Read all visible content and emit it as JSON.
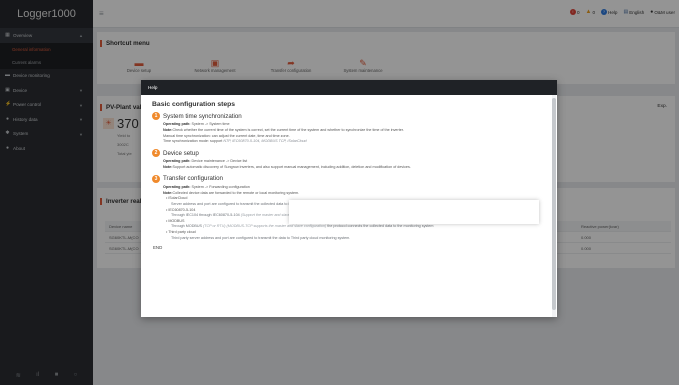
{
  "app": {
    "title": "Logger1000"
  },
  "header": {
    "alarm_count": "0",
    "warn_count": "0",
    "help": "Help",
    "language": "English",
    "user": "O&M user"
  },
  "sidebar": {
    "items": [
      {
        "label": "Overview",
        "icon": "grid-icon"
      },
      {
        "label": "General information",
        "sub": true,
        "active": true
      },
      {
        "label": "Current alarms",
        "sub": true
      },
      {
        "label": "Device monitoring",
        "icon": "monitor-icon"
      },
      {
        "label": "Device",
        "icon": "device-icon"
      },
      {
        "label": "Power control",
        "icon": "power-icon"
      },
      {
        "label": "History data",
        "icon": "history-icon"
      },
      {
        "label": "System",
        "icon": "gear-icon"
      },
      {
        "label": "About",
        "icon": "info-icon"
      }
    ]
  },
  "shortcut": {
    "title": "Shortcut menu",
    "items": [
      "Device setup",
      "Network management",
      "Transfer configuration",
      "System maintenance"
    ]
  },
  "pvplant": {
    "title": "PV-Plant values",
    "big_value": "370",
    "exp": "Exp.",
    "small1": "Yield to",
    "small2": "3002C",
    "small3": "Total yie"
  },
  "inverter": {
    "title": "Inverter realt",
    "col1": "Device name",
    "col2": "Reactive power(kvar)",
    "rows": [
      {
        "name": "SG60KTL-M(CO",
        "value": "0.000"
      },
      {
        "name": "SG60KTL-M(CO",
        "value": "0.000"
      }
    ]
  },
  "modal": {
    "header": "Help",
    "title": "Basic configuration steps",
    "steps": [
      {
        "num": "1",
        "title": "System time synchronization",
        "lines": [
          {
            "k": "Operating path:",
            "v": "System -> System time"
          },
          {
            "k": "Note:",
            "v": "Check whether the current time of the system is correct, set the current time of the system and whether to synchronize the time of the inverter."
          },
          {
            "k": "",
            "v": "Manual time synchronization: can adjust the current date, time and time zone."
          },
          {
            "k": "",
            "v": "Time synchronization mode: support ",
            "i": "NTP, IEC60870-5-104, MODBUS TCP, iSolarCloud"
          }
        ]
      },
      {
        "num": "2",
        "title": "Device setup",
        "lines": [
          {
            "k": "Operating path:",
            "v": "Device maintenance -> Device list"
          },
          {
            "k": "Note:",
            "v": "Support automatic discovery of Sungrow inverters, and also support manual management, including addition, deletion and modification of devices."
          }
        ]
      },
      {
        "num": "3",
        "title": "Transfer configuration",
        "lines": [
          {
            "k": "Operating path:",
            "v": "System -> Forwarding configuration"
          },
          {
            "k": "Note:",
            "v": "Collected device data are forwarded to the remote or local monitoring system."
          }
        ],
        "bullets": [
          {
            "t": "iSolarCloud",
            "sub": false
          },
          {
            "t": "Server address and port are configured to transmit the collected data to iSolarCloud",
            "sub": true
          },
          {
            "t": "IEC60870-5-104",
            "sub": false
          },
          {
            "t": "Through IEC104 through IEC60870-5-104",
            "i": " (Support the master and slave configuration)",
            "t2": " the protocol stack transmits the collected data to the monitoring system",
            "sub": true
          },
          {
            "t": "MODBUS",
            "sub": false
          },
          {
            "t": "Through MODBUS",
            "i": " (TCP or RTU) (MODBUS-TCP supports the master and slave configuration)",
            "t2": " the protocol connects the collected data to the monitoring system",
            "sub": true
          },
          {
            "t": "Third party cloud",
            "sub": false
          },
          {
            "t": "Third party server address and port are configured to transmit the data to Third party cloud monitoring system.",
            "sub": true
          }
        ]
      }
    ],
    "end": "END"
  }
}
